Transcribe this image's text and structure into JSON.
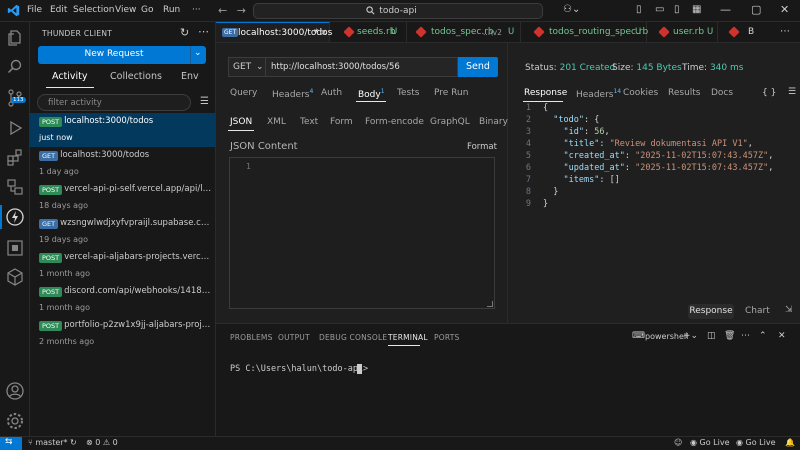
{
  "titlebar": {
    "menu": [
      "File",
      "Edit",
      "Selection",
      "View",
      "Go",
      "Run"
    ],
    "more": "···",
    "search": "todo-api"
  },
  "sidebar": {
    "title": "THUNDER CLIENT",
    "new_request": "New Request",
    "tabs": [
      "Activity",
      "Collections",
      "Env"
    ],
    "filter_placeholder": "filter activity",
    "activity": [
      {
        "method": "POST",
        "url": "localhost:3000/todos",
        "time": "just now"
      },
      {
        "method": "GET",
        "url": "localhost:3000/todos",
        "time": "1 day ago"
      },
      {
        "method": "POST",
        "url": "vercel-api-pi-self.vercel.app/api/logs.ts",
        "time": "18 days ago"
      },
      {
        "method": "GET",
        "url": "wzsngwlwdjxyfvpraijl.supabase.co/rest/v...",
        "time": "19 days ago"
      },
      {
        "method": "POST",
        "url": "vercel-api-aljabars-projects.vercel.app/...",
        "time": "1 month ago"
      },
      {
        "method": "POST",
        "url": "discord.com/api/webhooks/14183999...",
        "time": "1 month ago"
      },
      {
        "method": "POST",
        "url": "portfolio-p2zw1x9jj-aljabars-projects.v...",
        "time": "2 months ago"
      }
    ]
  },
  "activitybar": {
    "source_control_badge": "113"
  },
  "tabs": [
    {
      "badge": "GET",
      "label": "localhost:3000/todos",
      "dirty": "*",
      "close": "×"
    },
    {
      "label": "seeds.rb",
      "status": "U"
    },
    {
      "label": "todos_spec.rb",
      "path": "...\\v2",
      "status": "U"
    },
    {
      "label": "todos_routing_spec.rb",
      "status": "U"
    },
    {
      "label": "user.rb",
      "status": "U"
    },
    {
      "label": "B"
    }
  ],
  "request": {
    "method": "GET",
    "url": "http://localhost:3000/todos/56",
    "send": "Send",
    "tabs": [
      {
        "label": "Query"
      },
      {
        "label": "Headers",
        "count": "4"
      },
      {
        "label": "Auth"
      },
      {
        "label": "Body",
        "count": "1"
      },
      {
        "label": "Tests"
      },
      {
        "label": "Pre Run"
      }
    ],
    "body_tabs": [
      "JSON",
      "XML",
      "Text",
      "Form",
      "Form-encode",
      "GraphQL",
      "Binary"
    ],
    "json_label": "JSON Content",
    "format": "Format",
    "editor_line": "1"
  },
  "response": {
    "status_label": "Status:",
    "status": "201 Created",
    "size_label": "Size:",
    "size": "145 Bytes",
    "time_label": "Time:",
    "time": "340 ms",
    "tabs": [
      {
        "label": "Response"
      },
      {
        "label": "Headers",
        "count": "14"
      },
      {
        "label": "Cookies"
      },
      {
        "label": "Results"
      },
      {
        "label": "Docs"
      }
    ],
    "braces": "{ }",
    "lines": [
      "1",
      "2",
      "3",
      "4",
      "5",
      "6",
      "7",
      "8",
      "9"
    ],
    "body": {
      "id": "56",
      "title": "\"Review dokumentasi API V1\"",
      "created_at": "\"2025-11-02T15:07:43.457Z\"",
      "updated_at": "\"2025-11-02T15:07:43.457Z\"",
      "items": "[]"
    },
    "keys": {
      "todo": "\"todo\"",
      "id": "\"id\"",
      "title": "\"title\"",
      "created_at": "\"created_at\"",
      "updated_at": "\"updated_at\"",
      "items": "\"items\""
    },
    "response_btn": "Response",
    "chart_btn": "Chart"
  },
  "panel": {
    "tabs": [
      "PROBLEMS",
      "OUTPUT",
      "DEBUG CONSOLE",
      "TERMINAL",
      "PORTS"
    ],
    "shell": "powershell",
    "prompt": "PS C:\\Users\\halun\\todo-api>"
  },
  "statusbar": {
    "branch": "master*",
    "errors": "0",
    "warnings": "0",
    "golive1": "Go Live",
    "golive2": "Go Live"
  },
  "colors": {
    "accent": "#0078d4",
    "post": "#2e8b57",
    "get": "#3b6ea5",
    "status_ok": "#4ec9b0"
  }
}
